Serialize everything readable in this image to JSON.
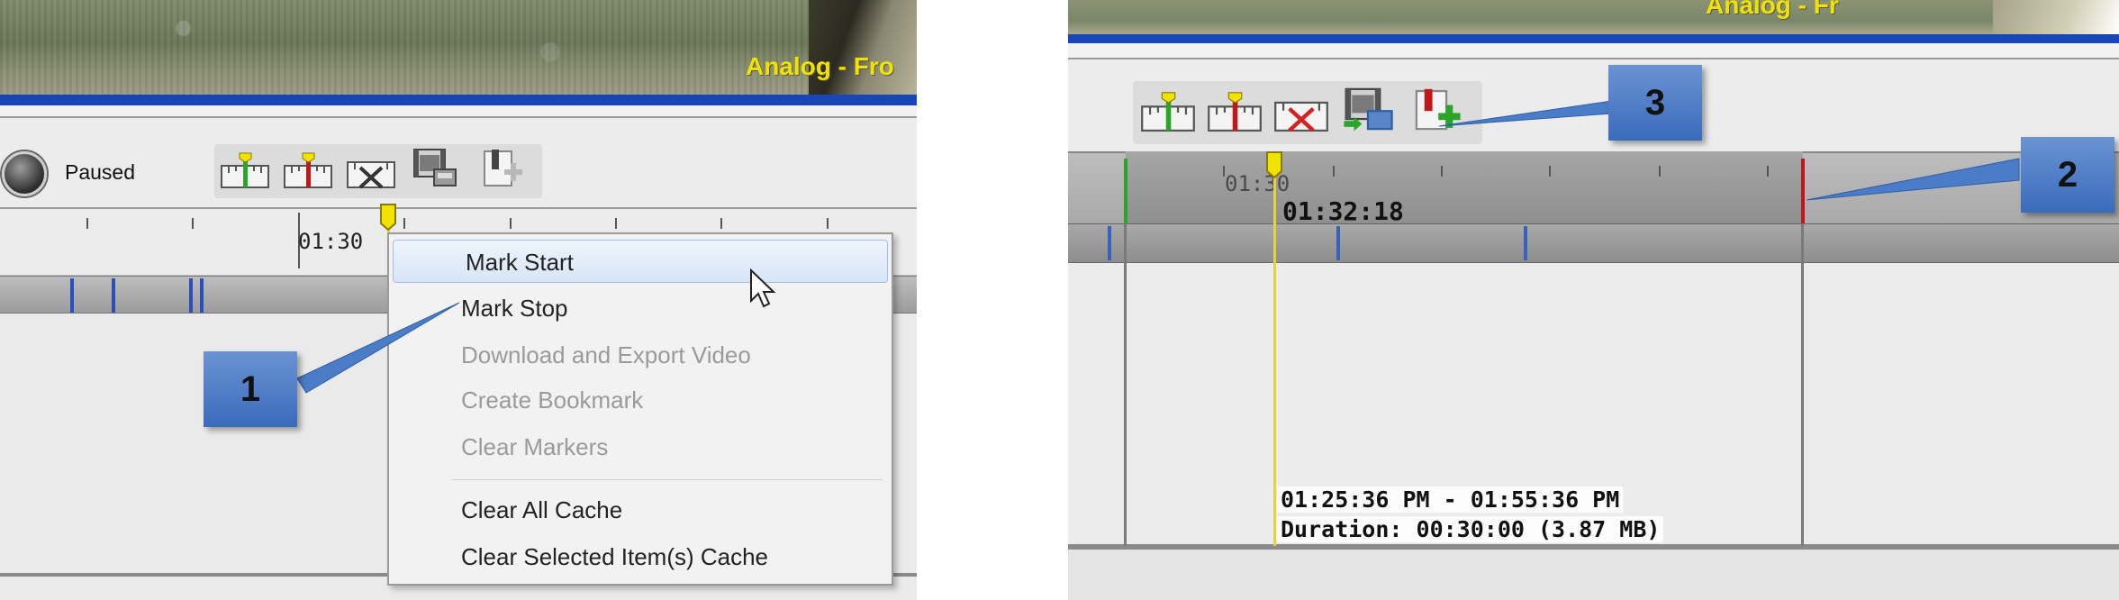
{
  "left_panel": {
    "video_overlay": "Analog - Fro",
    "status_label": "Paused",
    "timeline_label": "01:30",
    "context_menu": {
      "items": [
        {
          "label": "Mark Start",
          "enabled": true,
          "hover": true
        },
        {
          "label": "Mark Stop",
          "enabled": true
        },
        {
          "label": "Download and Export Video",
          "enabled": false
        },
        {
          "label": "Create Bookmark",
          "enabled": false
        },
        {
          "label": "Clear Markers",
          "enabled": false
        },
        {
          "label": "Clear All Cache",
          "enabled": true
        },
        {
          "label": "Clear Selected Item(s) Cache",
          "enabled": true
        }
      ]
    },
    "callout": "1"
  },
  "right_panel": {
    "video_overlay": "Analog - Fr",
    "timeline_label": "01:30",
    "playhead_time": "01:32:18",
    "range_label": "01:25:36 PM - 01:55:36 PM",
    "duration_label": "Duration: 00:30:00 (3.87 MB)",
    "callouts": [
      "3",
      "2"
    ]
  },
  "toolbar_icons": [
    "mark-start-icon",
    "mark-stop-icon",
    "clear-markers-icon",
    "export-video-icon",
    "create-bookmark-icon"
  ],
  "colors": {
    "accent_blue": "#1946b6",
    "callout_blue": "#4a7cc7",
    "start_marker": "#2aa52a",
    "stop_marker": "#c0181a",
    "playhead": "#e6d23c",
    "overlay_text": "#f2e200"
  }
}
